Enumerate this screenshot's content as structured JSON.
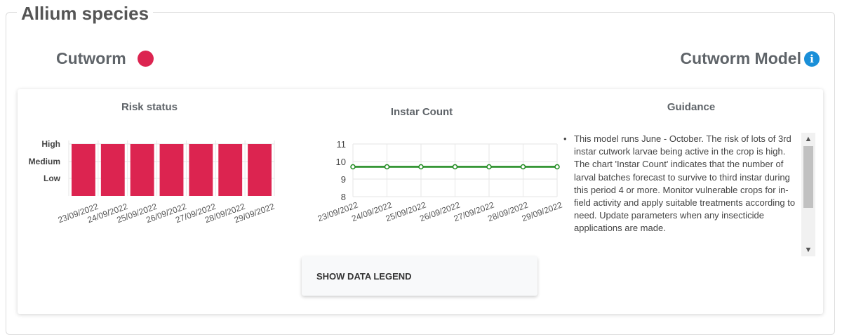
{
  "section": {
    "title": "Allium species"
  },
  "pest": {
    "name": "Cutworm",
    "status_color": "#dc2450"
  },
  "model": {
    "title": "Cutworm Model",
    "info_icon": "info-icon",
    "info_glyph": "i"
  },
  "risk_panel": {
    "title": "Risk status"
  },
  "instar_panel": {
    "title": "Instar Count"
  },
  "guidance": {
    "title": "Guidance",
    "bullet": "•",
    "text": "This model runs June - October. The risk of lots of 3rd instar cutwork larvae being active in the crop is high. The chart 'Instar Count' indicates that the number of larval batches forecast to survive to third instar during this period 4 or more. Monitor vulnerable crops for in-field activity and apply suitable treatments according to need. Update parameters when any insecticide applications are made."
  },
  "legend_button": {
    "label": "SHOW DATA LEGEND"
  },
  "colors": {
    "risk_bar": "#dc2450",
    "instar_line": "#1f8a1f"
  },
  "chart_data": [
    {
      "type": "bar",
      "title": "Risk status",
      "categories": [
        "23/09/2022",
        "24/09/2022",
        "25/09/2022",
        "26/09/2022",
        "27/09/2022",
        "28/09/2022",
        "29/09/2022"
      ],
      "y_categories": [
        "Low",
        "Medium",
        "High"
      ],
      "values": [
        "High",
        "High",
        "High",
        "High",
        "High",
        "High",
        "High"
      ],
      "grid": true
    },
    {
      "type": "line",
      "title": "Instar Count",
      "categories": [
        "23/09/2022",
        "24/09/2022",
        "25/09/2022",
        "26/09/2022",
        "27/09/2022",
        "28/09/2022",
        "29/09/2022"
      ],
      "values": [
        9.7,
        9.7,
        9.7,
        9.7,
        9.7,
        9.7,
        9.7
      ],
      "ylim": [
        8,
        11
      ],
      "yticks": [
        8,
        9,
        10,
        11
      ],
      "grid": true
    }
  ]
}
